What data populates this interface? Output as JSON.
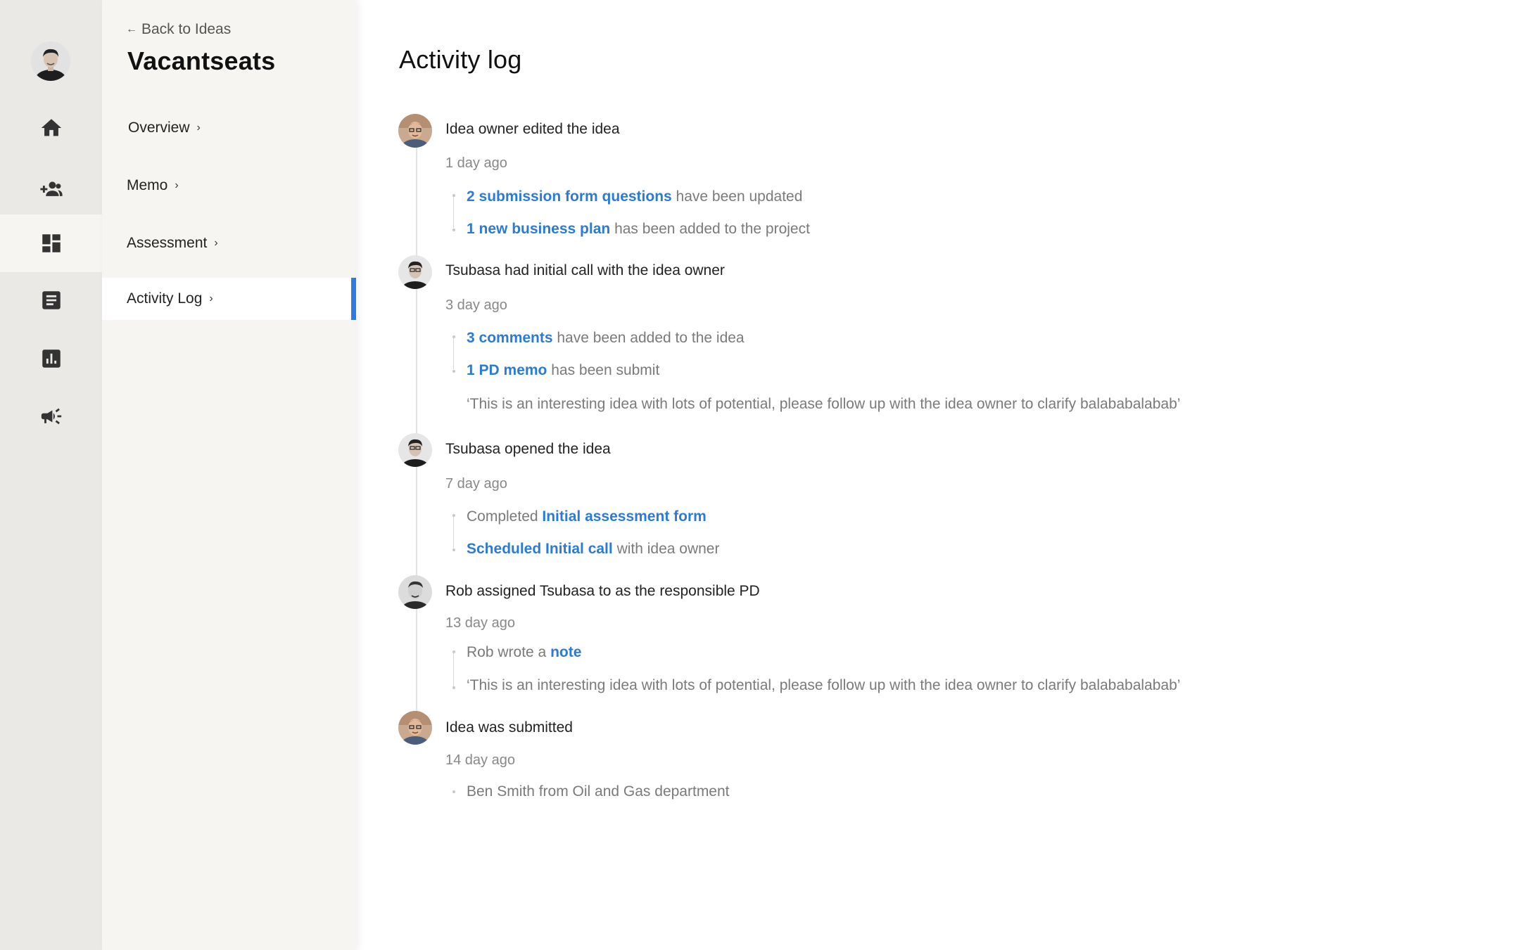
{
  "nav_rail": {
    "items": [
      {
        "name": "home-icon"
      },
      {
        "name": "people-add-icon"
      },
      {
        "name": "dashboard-icon"
      },
      {
        "name": "document-icon"
      },
      {
        "name": "chart-icon"
      },
      {
        "name": "megaphone-icon"
      }
    ]
  },
  "sidebar": {
    "back_label": "Back to Ideas",
    "project_title": "Vacantseats",
    "items": [
      {
        "label": "Overview"
      },
      {
        "label": "Memo"
      },
      {
        "label": "Assessment"
      },
      {
        "label": "Activity Log"
      }
    ]
  },
  "main": {
    "title": "Activity log",
    "events": [
      {
        "title": "Idea owner edited the idea",
        "time": "1 day ago",
        "details": [
          {
            "link": "2 submission form questions",
            "text": " have been updated"
          },
          {
            "link": "1 new business plan",
            "text": " has been added to the project"
          }
        ]
      },
      {
        "title": "Tsubasa had initial call with the idea owner",
        "time": "3 day ago",
        "details": [
          {
            "link": "3 comments",
            "text": " have been added to the idea"
          },
          {
            "link": "1 PD memo",
            "text": " has been submit"
          }
        ],
        "quote": "‘This is an interesting idea with lots of potential, please follow up with the idea owner to clarify balababalabab’"
      },
      {
        "title": "Tsubasa opened the idea",
        "time": "7 day ago",
        "details": [
          {
            "prefix": "Completed ",
            "link": "Initial assessment form"
          },
          {
            "link": "Scheduled Initial call",
            "text": " with idea owner"
          }
        ]
      },
      {
        "title": "Rob assigned Tsubasa to as the responsible PD",
        "time": "13 day ago",
        "details": [
          {
            "prefix": "Rob wrote a ",
            "link": "note"
          },
          {
            "text": "‘This is an interesting idea with lots of potential, please follow up with the idea owner to clarify balababalabab’"
          }
        ]
      },
      {
        "title": "Idea was submitted",
        "time": "14 day ago",
        "details": [
          {
            "text": "Ben Smith from Oil and Gas department"
          }
        ]
      }
    ]
  },
  "colors": {
    "accent": "#2f7be6",
    "link": "#2b7bd6",
    "rail_bg": "#ebe9e5",
    "sidebar_bg": "#f6f5f2"
  }
}
